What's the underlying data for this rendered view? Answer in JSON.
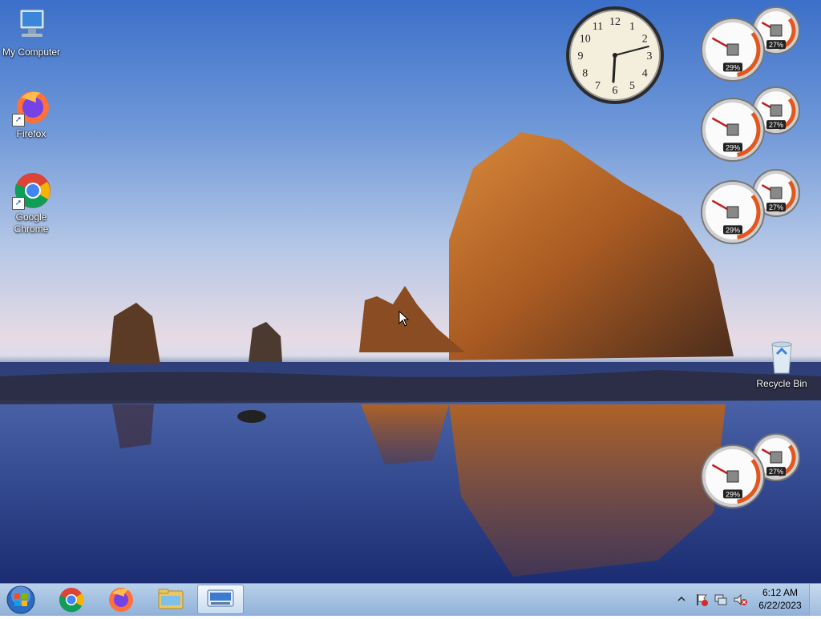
{
  "desktop": {
    "icons": [
      {
        "label": "My Computer"
      },
      {
        "label": "Firefox"
      },
      {
        "label": "Google Chrome"
      },
      {
        "label": "Recycle Bin"
      }
    ]
  },
  "gadgets": {
    "clock": {
      "numerals": [
        "12",
        "1",
        "2",
        "3",
        "4",
        "5",
        "6",
        "7",
        "8",
        "9",
        "10",
        "11"
      ]
    },
    "meters": [
      {
        "cpu": "29%",
        "memory": "27%"
      },
      {
        "cpu": "29%",
        "memory": "27%"
      },
      {
        "cpu": "29%",
        "memory": "27%"
      },
      {
        "cpu": "29%",
        "memory": "27%"
      }
    ]
  },
  "taskbar": {
    "pinned": [
      {
        "name": "start-button-icon"
      },
      {
        "name": "chrome-icon"
      },
      {
        "name": "firefox-icon"
      },
      {
        "name": "file-explorer-icon"
      },
      {
        "name": "on-screen-keyboard-icon"
      }
    ],
    "tray": {
      "time": "6:12 AM",
      "date": "6/22/2023"
    }
  },
  "colors": {
    "taskbar": "#a6c2e2",
    "rock": "#b86a2c",
    "sea": "#243c86"
  }
}
